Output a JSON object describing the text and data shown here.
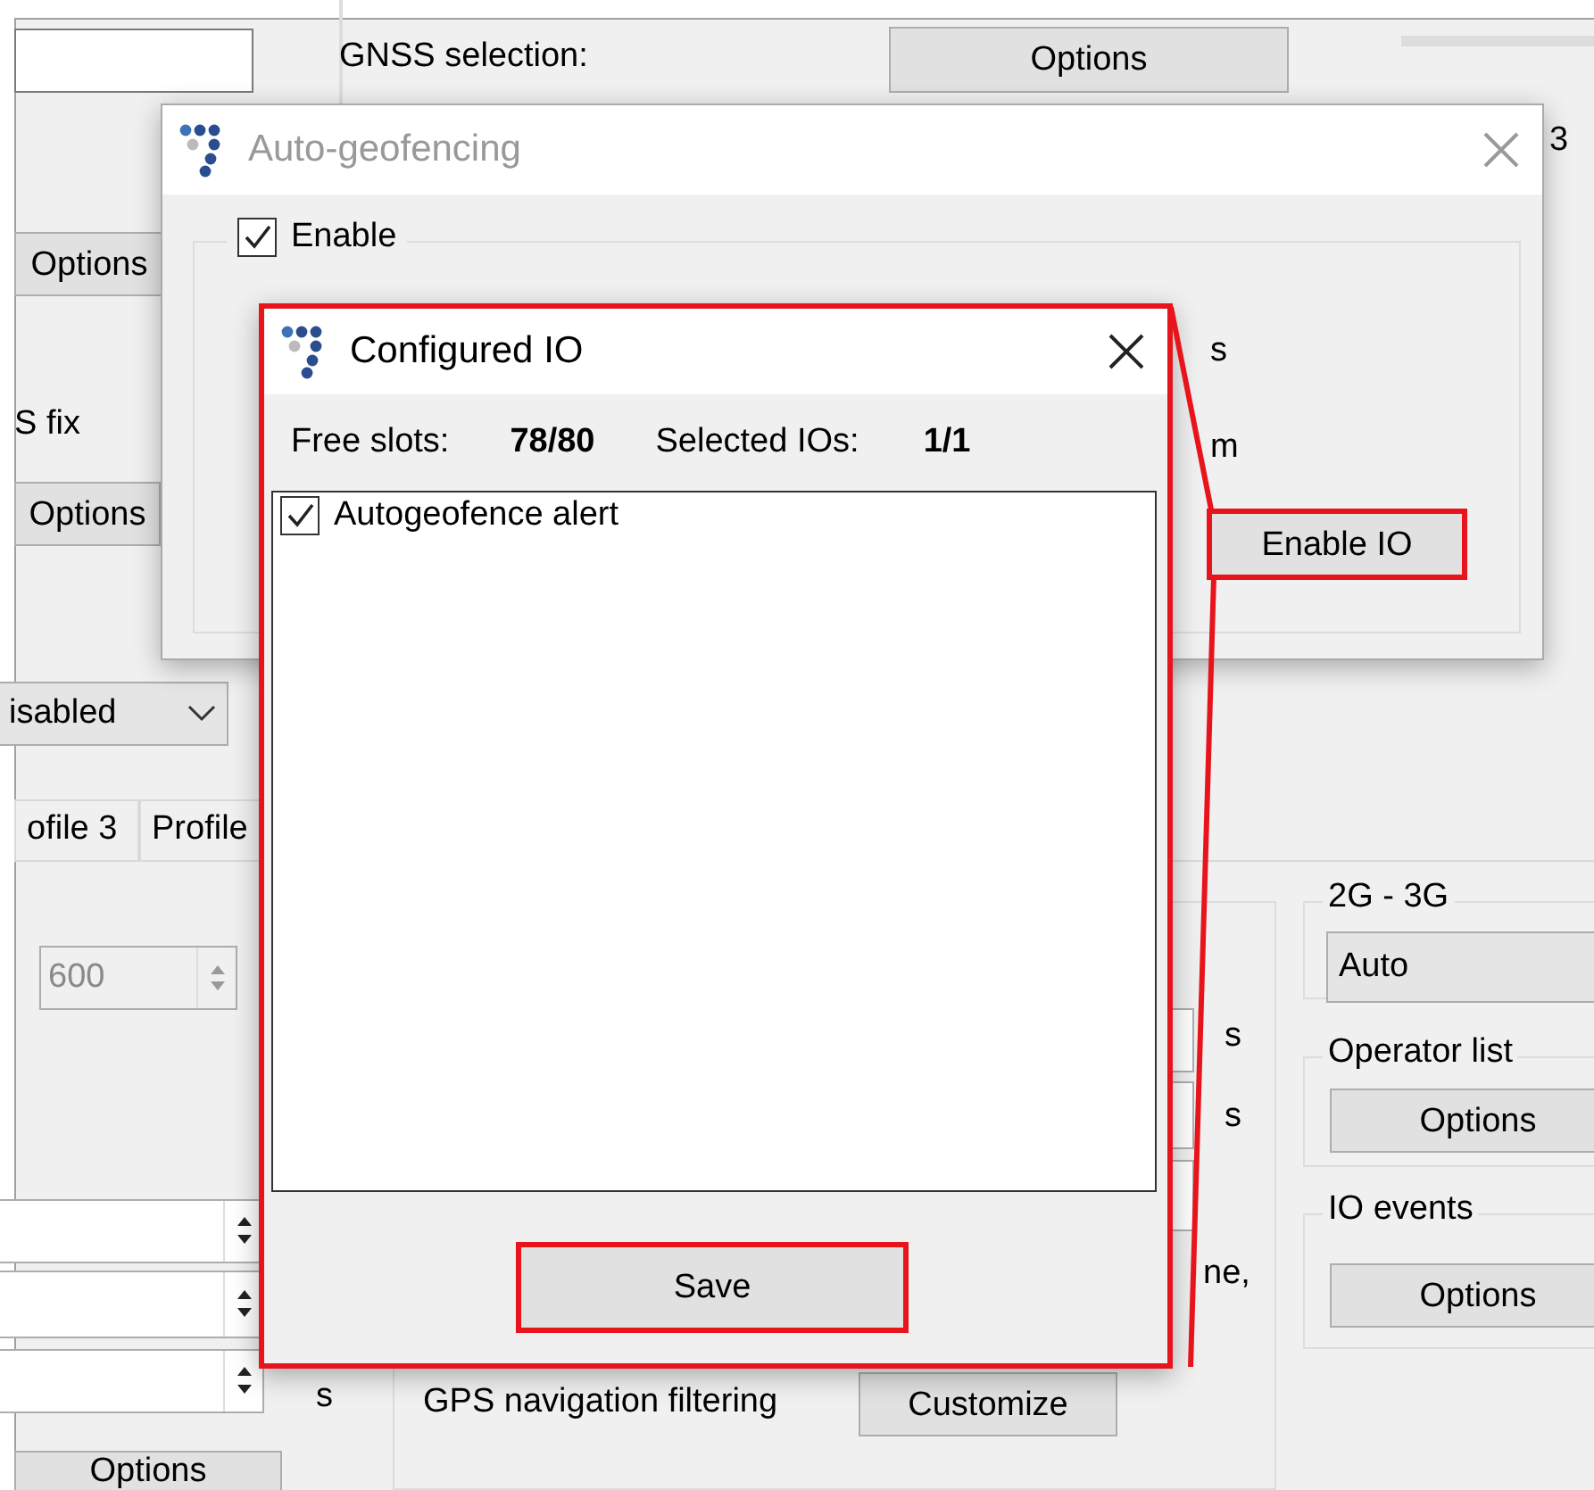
{
  "background": {
    "labels": [
      "GNSS selection:",
      "3",
      "S fix",
      "s",
      "s",
      "ne,",
      "s",
      "GPS navigation filtering"
    ],
    "buttons": [
      {
        "label": "Options",
        "highlighted": false
      },
      {
        "label": "Options",
        "highlighted": false
      },
      {
        "label": "Options",
        "highlighted": false
      },
      {
        "label": "Customize",
        "highlighted": false
      },
      {
        "label": "Options",
        "highlighted": false
      },
      {
        "label": "Options",
        "highlighted": false
      },
      {
        "label": "Options",
        "highlighted": false
      }
    ],
    "dropdowns": [
      {
        "value": "isabled"
      },
      {
        "value": "Auto"
      }
    ],
    "spinner": {
      "value": "600",
      "disabled": true
    },
    "tabs": [
      {
        "label": "ofile 3"
      },
      {
        "label": "Profile"
      }
    ],
    "groups": [
      "2G - 3G",
      "Operator list",
      "IO events"
    ]
  },
  "auto_geofencing": {
    "title": "Auto-geofencing",
    "active": false,
    "enable": {
      "label": "Enable",
      "checked": true
    },
    "units": [
      "s",
      "m"
    ],
    "enable_io": {
      "label": "Enable IO",
      "highlighted": true
    }
  },
  "configured_io": {
    "title": "Configured IO",
    "active": true,
    "highlighted": true,
    "free_slots_label": "Free slots:",
    "free_slots": "78/80",
    "selected_label": "Selected IOs:",
    "selected": "1/1",
    "items": [
      {
        "label": "Autogeofence alert",
        "checked": true
      }
    ],
    "save": {
      "label": "Save",
      "highlighted": true
    }
  }
}
